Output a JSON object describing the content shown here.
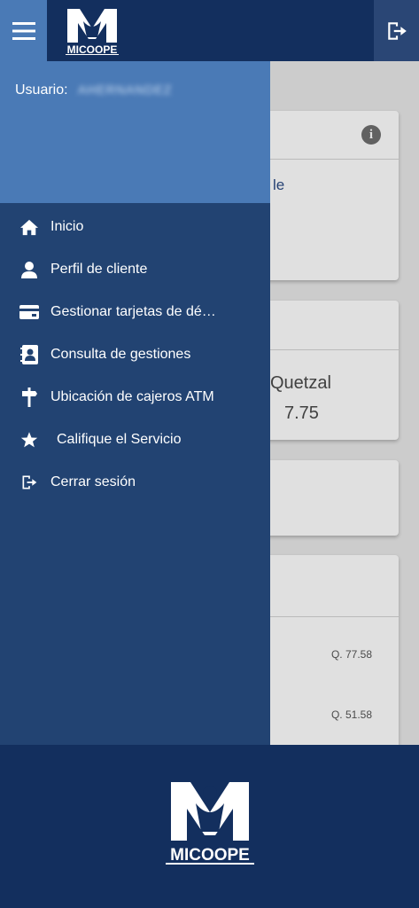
{
  "app": {
    "logo_text": "MICOOPE",
    "colors": {
      "primary": "#132f5e",
      "drawer": "#224372",
      "accent": "#4a7ab6"
    }
  },
  "topbar": {
    "menu_icon": "hamburger-menu-icon",
    "logout_icon": "logout-icon"
  },
  "drawer": {
    "user_label": "Usuario:",
    "user_value": "AHERNANDEZ",
    "items": [
      {
        "label": "Inicio",
        "icon": "home-icon"
      },
      {
        "label": "Perfil de cliente",
        "icon": "person-icon"
      },
      {
        "label": "Gestionar tarjetas de débi…",
        "icon": "credit-card-icon"
      },
      {
        "label": "Consulta de gestiones",
        "icon": "contact-book-icon"
      },
      {
        "label": "Ubicación de cajeros ATM",
        "icon": "signpost-icon"
      },
      {
        "label": "Califique el Servicio",
        "icon": "star-icon"
      },
      {
        "label": "Cerrar sesión",
        "icon": "logout-icon"
      }
    ]
  },
  "background": {
    "card1_partial_text": "le",
    "currency_name": "Quetzal",
    "currency_rate": "7.75",
    "amounts": [
      "Q. 77.58",
      "Q. 51.58"
    ]
  }
}
